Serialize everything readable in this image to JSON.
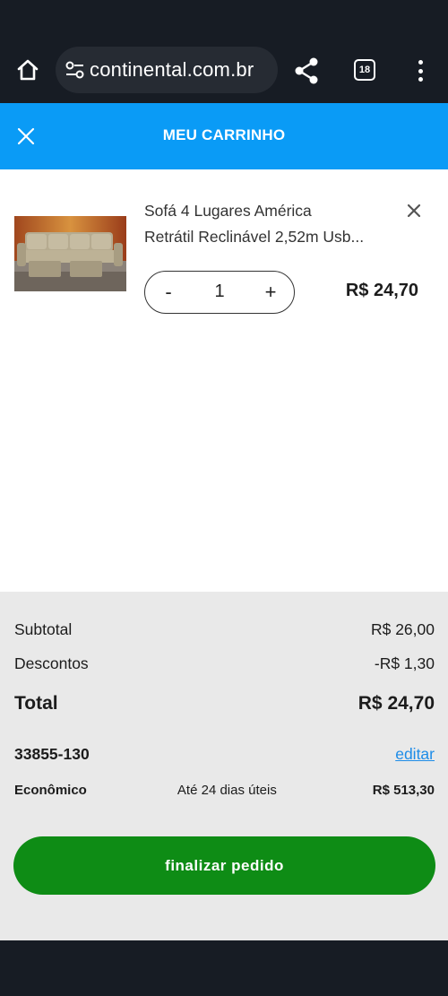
{
  "browser": {
    "url": "continental.com.br",
    "tab_count": "18",
    "icons": [
      "home-icon",
      "site-settings-icon",
      "share-icon",
      "tab-switcher-icon",
      "more-vert-icon"
    ]
  },
  "header": {
    "title": "MEU CARRINHO",
    "close_icon": "close-icon",
    "color": "#0a9bf6"
  },
  "cart": {
    "items": [
      {
        "name_line1": "Sofá 4 Lugares América",
        "name_line2": "Retrátil Reclinável 2,52m Usb...",
        "quantity": "1",
        "qty_minus": "-",
        "qty_plus": "+",
        "price": "R$ 24,70",
        "image": "sofa-product-image"
      }
    ]
  },
  "summary": {
    "subtotal_label": "Subtotal",
    "subtotal_value": "R$ 26,00",
    "discount_label": "Descontos",
    "discount_value": "-R$ 1,30",
    "total_label": "Total",
    "total_value": "R$ 24,70",
    "cep": "33855-130",
    "edit_label": "editar",
    "shipping": {
      "name": "Econômico",
      "eta": "Até 24 dias úteis",
      "price": "R$ 513,30"
    },
    "checkout_label": "finalizar pedido",
    "checkout_color": "#0e8c15"
  }
}
